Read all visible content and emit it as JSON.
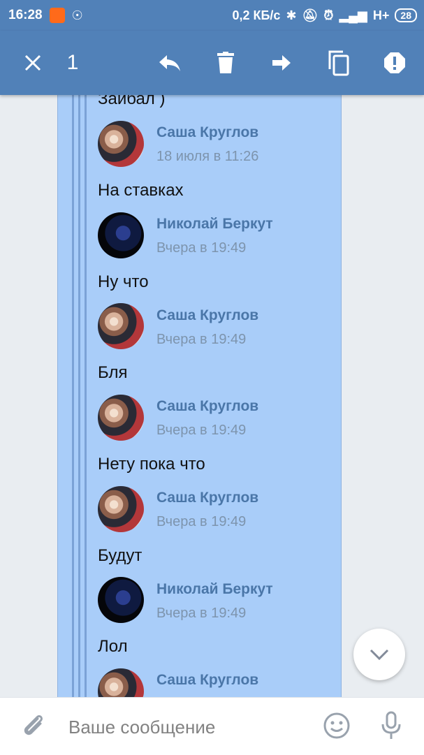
{
  "status_bar": {
    "time": "16:28",
    "speed": "0,2 КБ/с",
    "network": "H+",
    "battery": "28"
  },
  "action_bar": {
    "selected_count": "1",
    "icons": [
      "close-icon",
      "reply-icon",
      "delete-icon",
      "forward-icon",
      "copy-icon",
      "report-icon"
    ]
  },
  "messages": [
    {
      "text": "Заибал )"
    },
    {
      "author": "Саша Круглов",
      "date": "18 июля в 11:26",
      "text": "На ставках"
    },
    {
      "author": "Николай Беркут",
      "date": "Вчера в 19:49",
      "text": "Ну что"
    },
    {
      "author": "Саша Круглов",
      "date": "Вчера в 19:49",
      "text": "Бля"
    },
    {
      "author": "Саша Круглов",
      "date": "Вчера в 19:49",
      "text": "Нету пока что"
    },
    {
      "author": "Саша Круглов",
      "date": "Вчера в 19:49",
      "text": "Будут"
    },
    {
      "author": "Николай Беркут",
      "date": "Вчера в 19:49",
      "text": "Лол"
    },
    {
      "author": "Саша Круглов"
    }
  ],
  "composer": {
    "placeholder": "Ваше сообщение"
  },
  "colors": {
    "header": "#5181b8",
    "selected_bubble": "#a9cdf9",
    "author_name": "#4a76a8"
  }
}
